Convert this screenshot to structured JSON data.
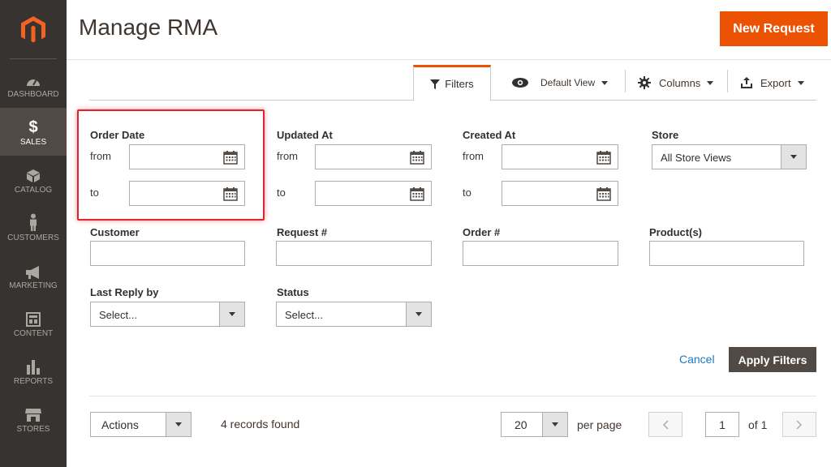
{
  "sidebar": {
    "items": [
      {
        "label": "DASHBOARD",
        "icon": "dashboard-icon"
      },
      {
        "label": "SALES",
        "icon": "dollar-icon",
        "active": true
      },
      {
        "label": "CATALOG",
        "icon": "cube-icon"
      },
      {
        "label": "CUSTOMERS",
        "icon": "person-icon"
      },
      {
        "label": "MARKETING",
        "icon": "megaphone-icon"
      },
      {
        "label": "CONTENT",
        "icon": "layout-icon"
      },
      {
        "label": "REPORTS",
        "icon": "bar-chart-icon"
      },
      {
        "label": "STORES",
        "icon": "store-icon"
      }
    ]
  },
  "header": {
    "title": "Manage RMA",
    "new_request_label": "New Request"
  },
  "toolbar": {
    "filters_label": "Filters",
    "default_view_label": "Default View",
    "columns_label": "Columns",
    "export_label": "Export"
  },
  "filters": {
    "order_date": {
      "label": "Order Date",
      "from": "from",
      "to": "to"
    },
    "updated_at": {
      "label": "Updated At",
      "from": "from",
      "to": "to"
    },
    "created_at": {
      "label": "Created At",
      "from": "from",
      "to": "to"
    },
    "store": {
      "label": "Store",
      "value": "All Store Views"
    },
    "customer": {
      "label": "Customer"
    },
    "request_no": {
      "label": "Request #"
    },
    "order_no": {
      "label": "Order #"
    },
    "products": {
      "label": "Product(s)"
    },
    "last_reply_by": {
      "label": "Last Reply by",
      "value": "Select..."
    },
    "status": {
      "label": "Status",
      "value": "Select..."
    },
    "cancel_label": "Cancel",
    "apply_label": "Apply Filters"
  },
  "grid": {
    "actions_label": "Actions",
    "records_found": "4 records found",
    "per_page_value": "20",
    "per_page_label": "per page",
    "current_page": "1",
    "of_pages": "of 1"
  },
  "colors": {
    "accent": "#eb5202",
    "sidebar_bg": "#373330",
    "highlight": "#e0242f",
    "link": "#1979c3",
    "apply_bg": "#514943"
  }
}
